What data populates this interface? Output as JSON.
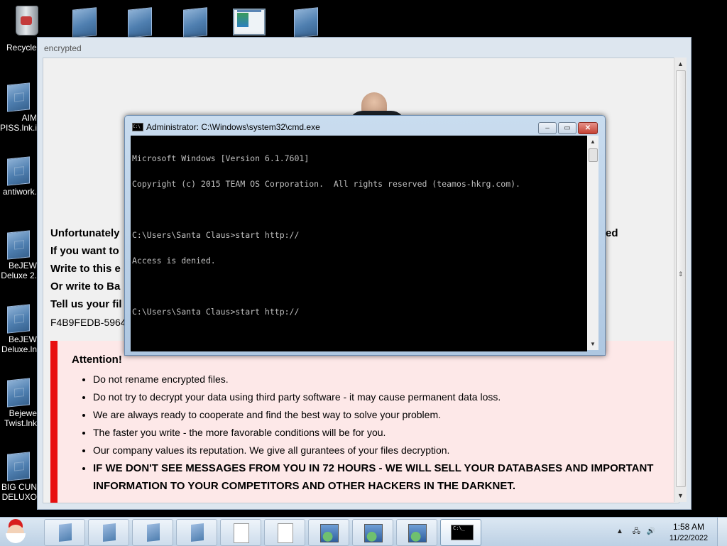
{
  "desktop": {
    "icons": [
      {
        "label": "Recycle"
      },
      {
        "label": "AIM\nPISS.lnk.i"
      },
      {
        "label": "antiwork."
      },
      {
        "label": "BeJEW\nDeluxe 2."
      },
      {
        "label": "BeJEW\nDeluxe.ln"
      },
      {
        "label": "Bejewe\nTwist.lnk"
      },
      {
        "label": "BIG CUN\nDELUXO"
      }
    ]
  },
  "ransom_window": {
    "title": "encrypted",
    "lines": [
      {
        "text": "Unfortunately"
      },
      {
        "text": "If you want to"
      },
      {
        "text": "Write to this e"
      },
      {
        "text": "Or write to Ba"
      },
      {
        "text": "Tell us your fil"
      },
      {
        "text": "F4B9FEDB-5964"
      }
    ],
    "line_tail": "ed",
    "attention": {
      "heading": "Attention!",
      "items": [
        "Do not rename encrypted files.",
        "Do not try to decrypt your data using third party software - it may cause permanent data loss.",
        "We are always ready to cooperate and find the best way to solve your problem.",
        "The faster you write - the more favorable conditions will be for you.",
        "Our company values its reputation. We give all gurantees of your files decryption.",
        "IF WE DON'T SEE MESSAGES FROM YOU IN 72 HOURS - WE WILL SELL YOUR DATABASES AND IMPORTANT INFORMATION TO YOUR COMPETITORS AND OTHER HACKERS IN THE DARKNET."
      ]
    }
  },
  "cmd_window": {
    "title": "Administrator: C:\\Windows\\system32\\cmd.exe",
    "icon_text": "C:\\",
    "console_lines": [
      "Microsoft Windows [Version 6.1.7601]",
      "Copyright (c) 2015 TEAM OS Corporation.  All rights reserved (teamos-hkrg.com).",
      "",
      "C:\\Users\\Santa Claus>start http://",
      "Access is denied.",
      "",
      "C:\\Users\\Santa Claus>start http://"
    ]
  },
  "taskbar": {
    "console_icon_text": "C:\\_",
    "time": "1:58 AM",
    "date": "11/22/2022"
  }
}
